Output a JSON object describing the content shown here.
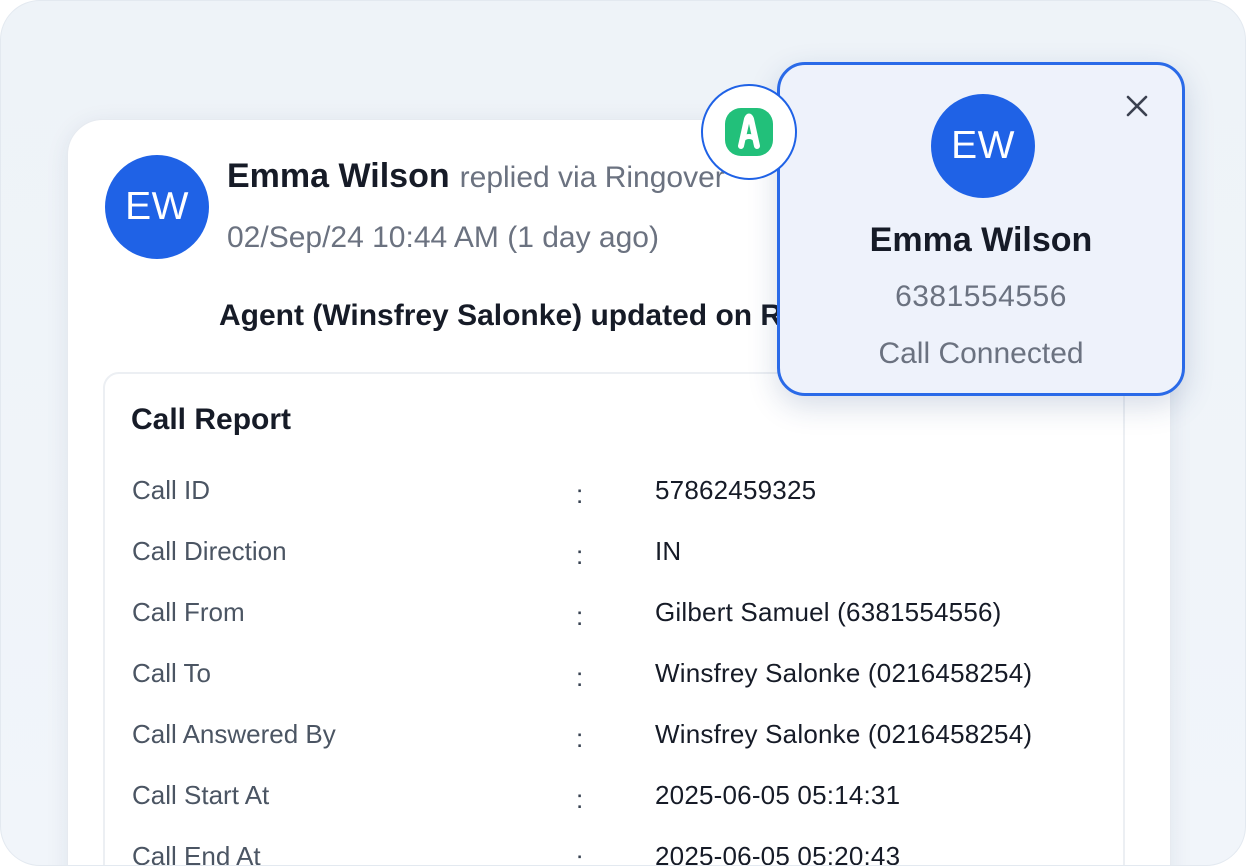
{
  "message": {
    "avatar_initials": "EW",
    "sender_name": "Emma Wilson",
    "via_text": "replied via Ringover",
    "timestamp": "02/Sep/24 10:44 AM (1 day ago)",
    "agent_update": "Agent (Winsfrey Salonke) updated on R"
  },
  "report": {
    "title": "Call Report",
    "separator": ":",
    "rows": [
      {
        "label": "Call ID",
        "value": "57862459325"
      },
      {
        "label": "Call Direction",
        "value": "IN"
      },
      {
        "label": "Call From",
        "value": "Gilbert Samuel (6381554556)"
      },
      {
        "label": "Call To",
        "value": "Winsfrey Salonke (0216458254)"
      },
      {
        "label": "Call Answered By",
        "value": "Winsfrey Salonke (0216458254)"
      },
      {
        "label": "Call Start At",
        "value": "2025-06-05 05:14:31"
      },
      {
        "label": "Call End At",
        "value": "2025-06-05 05:20:43"
      }
    ]
  },
  "popup": {
    "avatar_initials": "EW",
    "name": "Emma Wilson",
    "phone": "6381554556",
    "status": "Call Connected",
    "close_icon": "close-icon"
  },
  "logo": {
    "icon": "ringover-logo-icon",
    "color": "#22c07a"
  },
  "colors": {
    "accent": "#1f62e6",
    "popup_border": "#2a6ae8",
    "logo_green": "#22c07a"
  }
}
